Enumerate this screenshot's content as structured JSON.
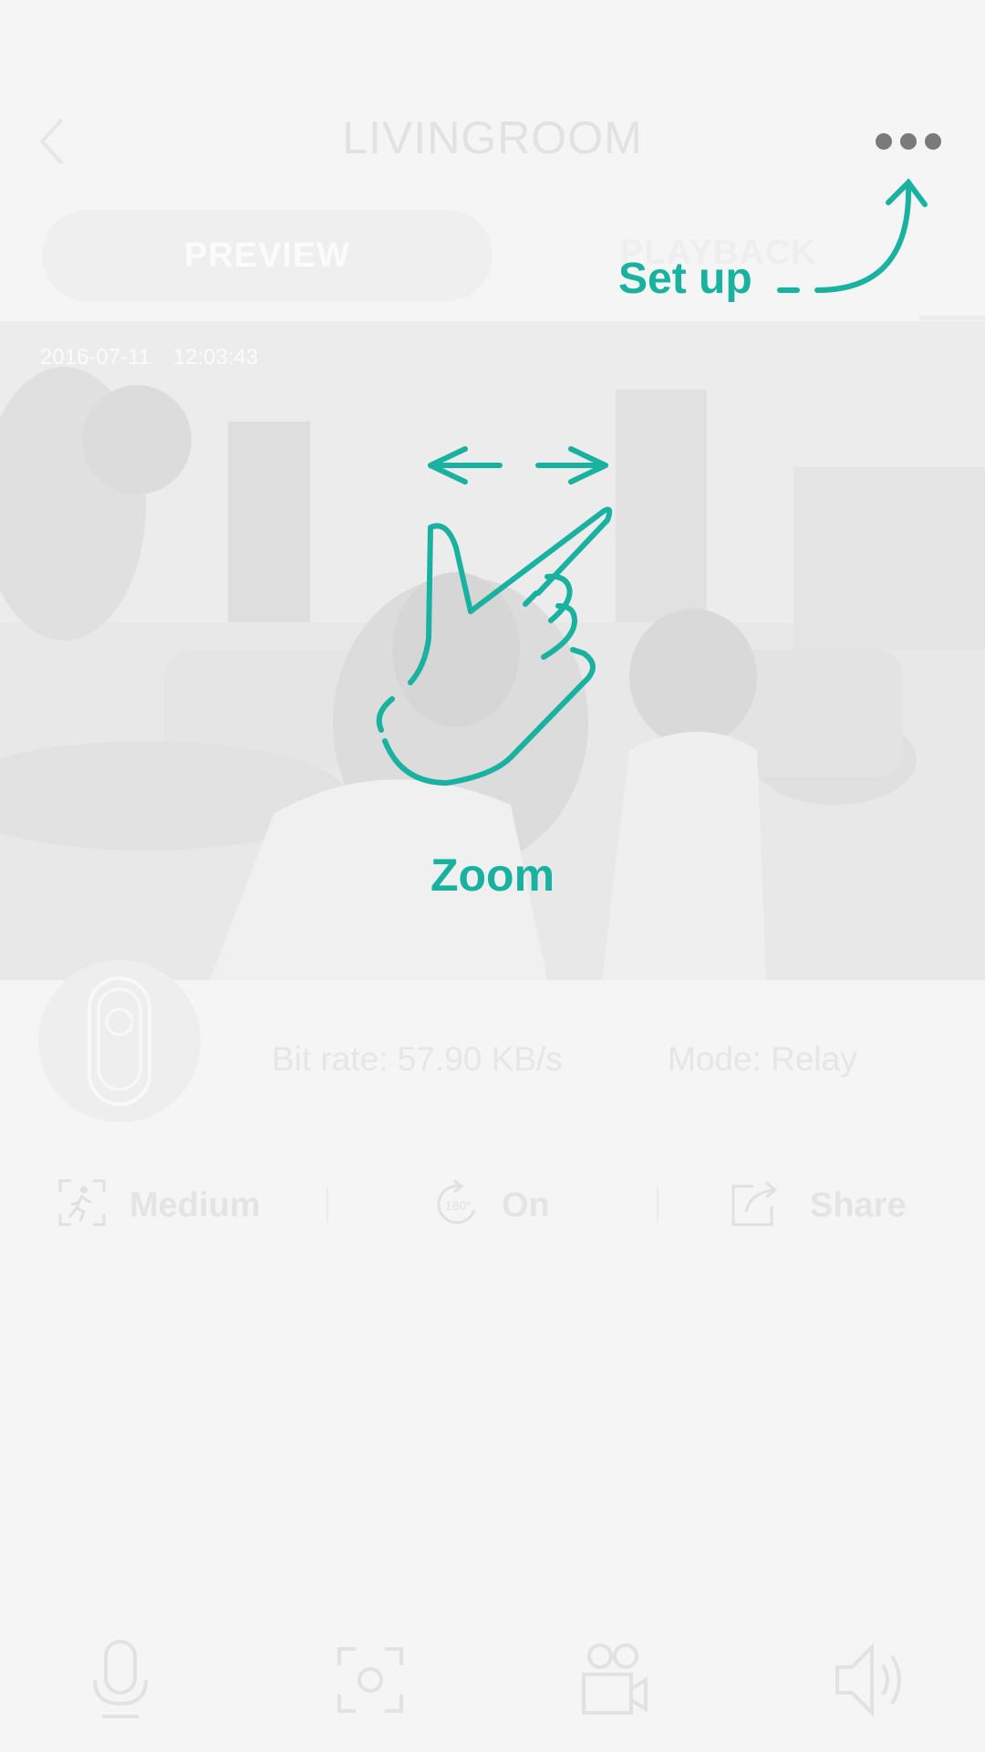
{
  "header": {
    "title": "LIVINGROOM",
    "back_icon": "chevron-left-icon",
    "more_icon": "more-horizontal-icon"
  },
  "tabs": [
    {
      "label": "PREVIEW",
      "selected": true
    },
    {
      "label": "PLAYBACK",
      "selected": false
    }
  ],
  "video": {
    "timestamp": "2016-07-11   12:03:43"
  },
  "info": {
    "bitrate": "Bit rate: 57.90 KB/s",
    "mode": "Mode: Relay"
  },
  "options": [
    {
      "label": "Medium",
      "icon": "motion-detection-icon"
    },
    {
      "label": "On",
      "icon": "rotate-180-icon"
    },
    {
      "label": "Share",
      "icon": "share-icon"
    }
  ],
  "bottom_bar": [
    {
      "icon": "microphone-icon"
    },
    {
      "icon": "snapshot-icon"
    },
    {
      "icon": "record-icon"
    },
    {
      "icon": "speaker-icon"
    }
  ],
  "overlay": {
    "setup_label": "Set up",
    "zoom_label": "Zoom",
    "accent_color": "#19b2a1"
  }
}
